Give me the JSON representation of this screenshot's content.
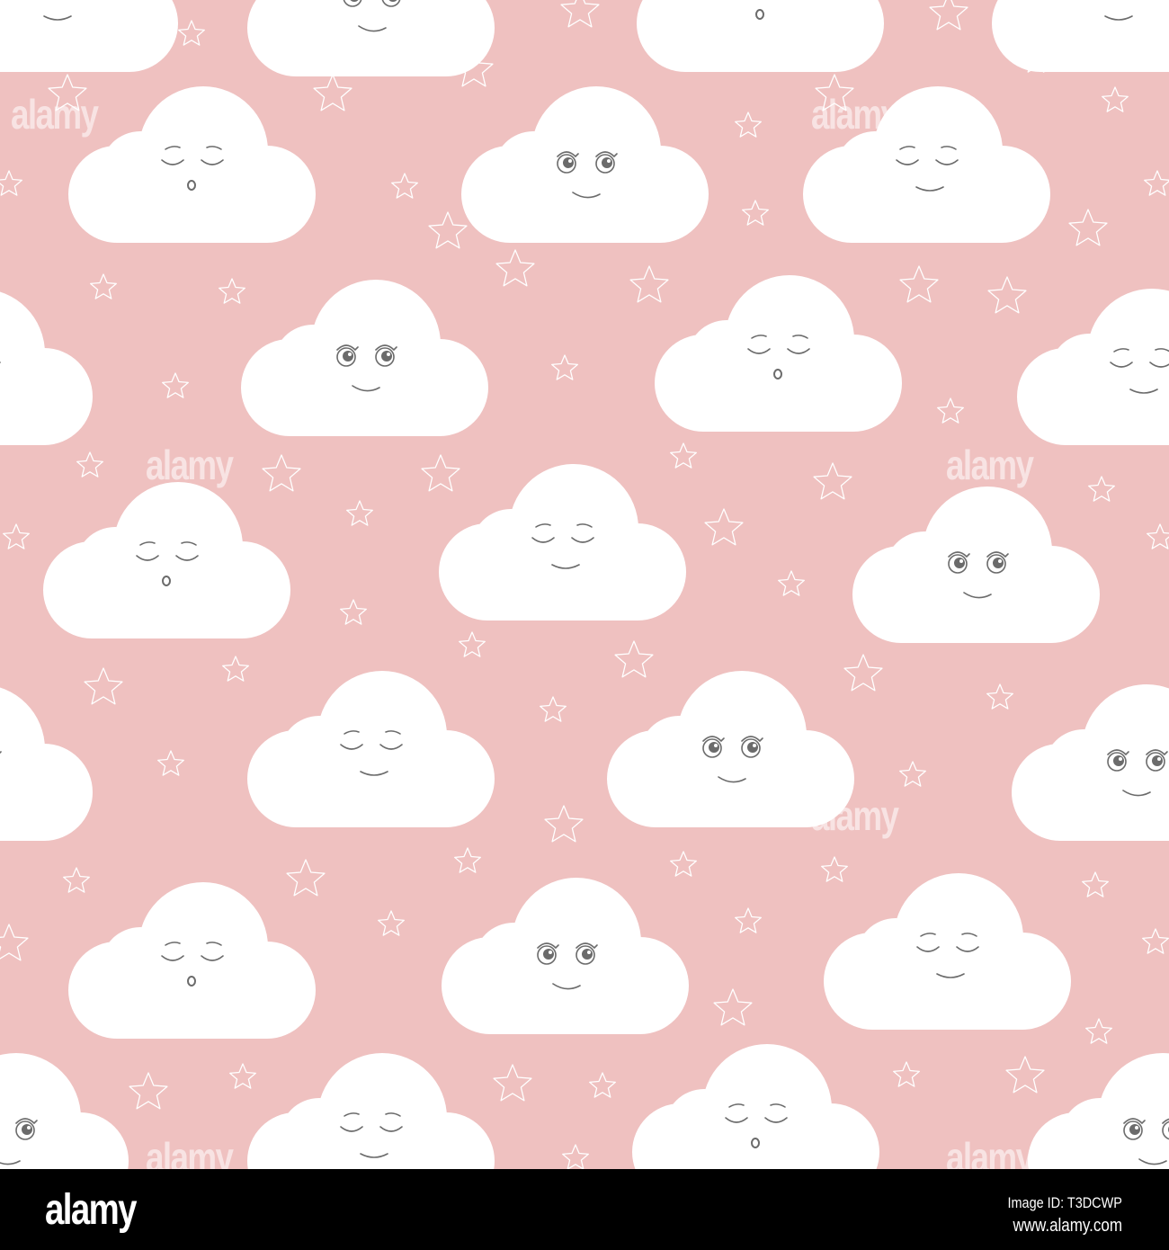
{
  "watermark": "alamy",
  "footer": {
    "logo": "alamy",
    "image_id": "Image ID: T3DCWP",
    "url": "www.alamy.com"
  },
  "colors": {
    "background": "#efc1c0",
    "cloud": "#ffffff",
    "face": "#6b6b6b",
    "footer": "#000000"
  }
}
